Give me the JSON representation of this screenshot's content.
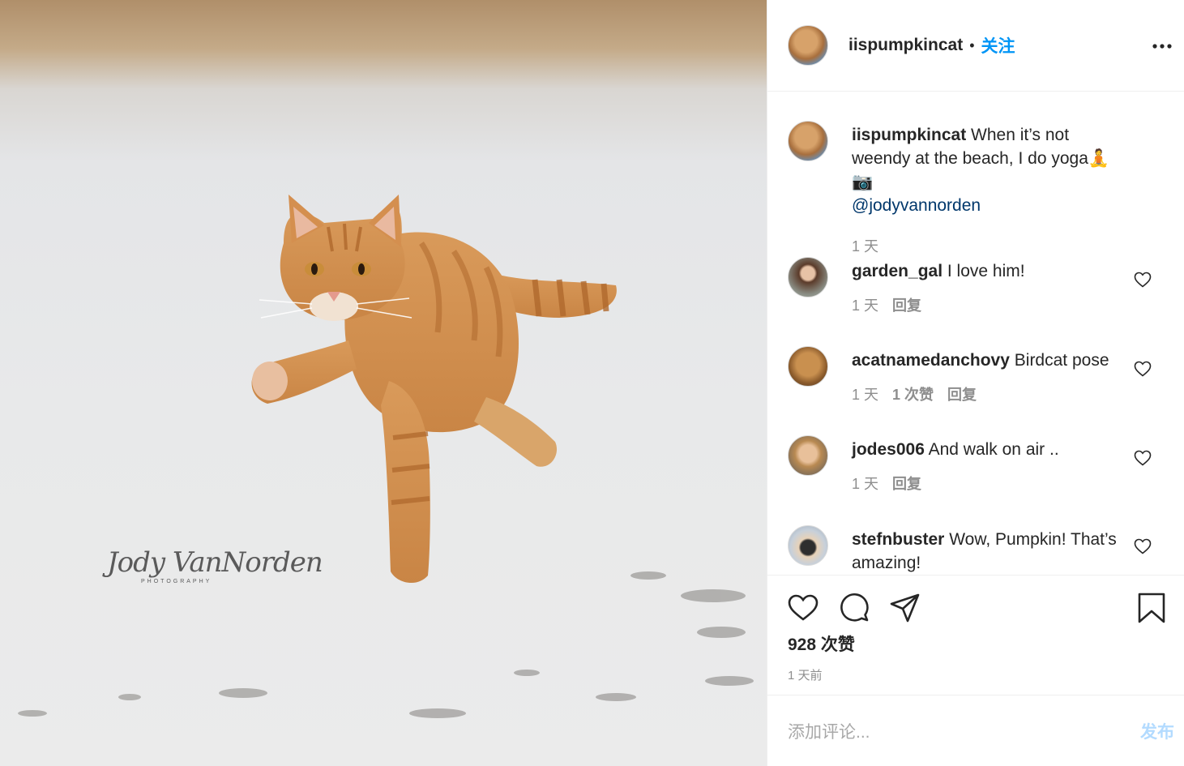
{
  "photo": {
    "watermark_name": "Jody VanNorden",
    "watermark_sub": "PHOTOGRAPHY"
  },
  "header": {
    "username": "iispumpkincat",
    "separator": "•",
    "follow_label": "关注"
  },
  "caption": {
    "username": "iispumpkincat",
    "text": "When it’s not weendy at the beach, I do yoga🧘 📷",
    "mention": "@jodyvannorden",
    "time": "1 天"
  },
  "comments": [
    {
      "username": "garden_gal",
      "text": "I love him!",
      "time": "1 天",
      "likes": "",
      "reply": "回复"
    },
    {
      "username": "acatnamedanchovy",
      "text": "Birdcat pose",
      "time": "1 天",
      "likes": "1 次赞",
      "reply": "回复"
    },
    {
      "username": "jodes006",
      "text": "And walk on air ..",
      "time": "1 天",
      "likes": "",
      "reply": "回复"
    },
    {
      "username": "stefnbuster",
      "text": "Wow, Pumpkin! That’s amazing!",
      "time": "",
      "likes": "",
      "reply": ""
    }
  ],
  "footer": {
    "likes_count": "928 次赞",
    "posted_time": "1 天前",
    "comment_placeholder": "添加评论...",
    "post_label": "发布"
  },
  "colors": {
    "accent": "#0095f6",
    "mention": "#00376b",
    "muted": "#8e8e8e",
    "post_disabled": "#b3dbff"
  },
  "icons": [
    "more-icon",
    "heart-icon",
    "comment-icon",
    "share-icon",
    "bookmark-icon"
  ]
}
